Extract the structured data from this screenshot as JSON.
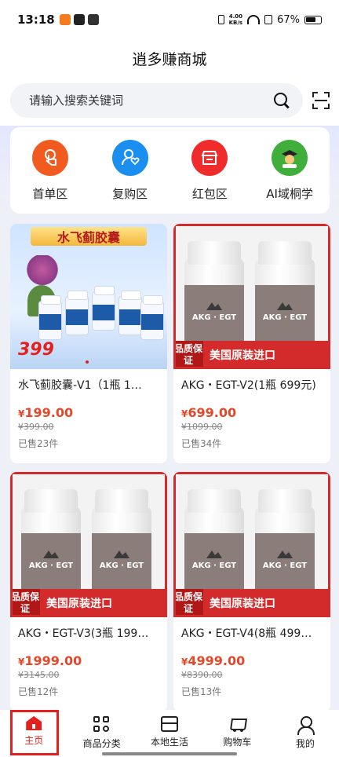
{
  "status_bar": {
    "time": "13:18",
    "net_speed_value": "4.00",
    "net_speed_unit": "KB/s",
    "battery": "67%"
  },
  "header": {
    "title": "逍多赚商城"
  },
  "search": {
    "placeholder": "请输入搜索关键词"
  },
  "quick_nav": [
    {
      "label": "首单区",
      "icon": "hand-tap-icon",
      "color": "#f25b1f"
    },
    {
      "label": "复购区",
      "icon": "user-heart-icon",
      "color": "#1b8ff0"
    },
    {
      "label": "红包区",
      "icon": "store-icon",
      "color": "#ef2b2b"
    },
    {
      "label": "AI域桐学",
      "icon": "graduate-avatar-icon",
      "color": "#3fae3a"
    }
  ],
  "products": [
    {
      "name": "水飞蓟胶囊-V1（1瓶 1…",
      "price": "199.00",
      "original_price": "¥399.00",
      "sold": "已售23件",
      "banner": "水飞蓟胶囊",
      "price_tag": "399"
    },
    {
      "name": "AKG・EGT-V2(1瓶 699元)",
      "price": "699.00",
      "original_price": "¥1099.00",
      "sold": "已售34件",
      "quality_badge": "品质保证",
      "origin_badge": "美国原装进口",
      "label": "AKG · EGT"
    },
    {
      "name": "AKG・EGT-V3(3瓶 199…",
      "price": "1999.00",
      "original_price": "¥3145.00",
      "sold": "已售12件",
      "quality_badge": "品质保证",
      "origin_badge": "美国原装进口",
      "label": "AKG · EGT"
    },
    {
      "name": "AKG・EGT-V4(8瓶 499…",
      "price": "4999.00",
      "original_price": "¥8390.00",
      "sold": "已售13件",
      "quality_badge": "品质保证",
      "origin_badge": "美国原装进口",
      "label": "AKG · EGT"
    }
  ],
  "currency_symbol": "¥",
  "bottom_nav": [
    {
      "label": "主页",
      "icon": "home-icon",
      "active": true
    },
    {
      "label": "商品分类",
      "icon": "category-grid-icon",
      "active": false
    },
    {
      "label": "本地生活",
      "icon": "store-icon",
      "active": false
    },
    {
      "label": "购物车",
      "icon": "cart-icon",
      "active": false
    },
    {
      "label": "我的",
      "icon": "user-icon",
      "active": false
    }
  ]
}
